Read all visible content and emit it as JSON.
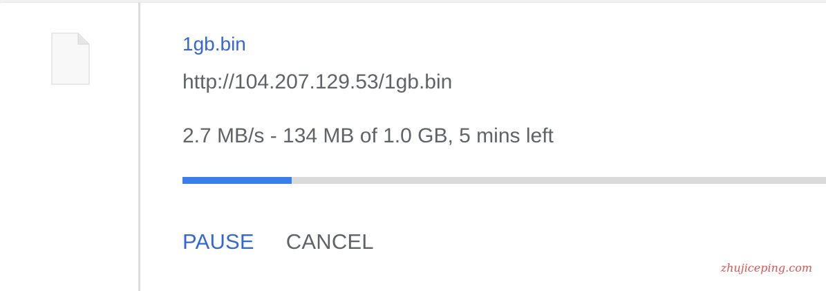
{
  "download": {
    "file_name": "1gb.bin",
    "url": "http://104.207.129.53/1gb.bin",
    "status": "2.7 MB/s - 134 MB of 1.0 GB, 5 mins left",
    "progress_fraction": 0.17,
    "icon": "file-icon"
  },
  "actions": {
    "pause_label": "PAUSE",
    "cancel_label": "CANCEL"
  },
  "watermark": "zhujiceping.com",
  "colors": {
    "link_blue": "#3367d6",
    "progress_blue": "#3b7de9",
    "text_gray": "#5f6368",
    "track_gray": "#dadada"
  }
}
